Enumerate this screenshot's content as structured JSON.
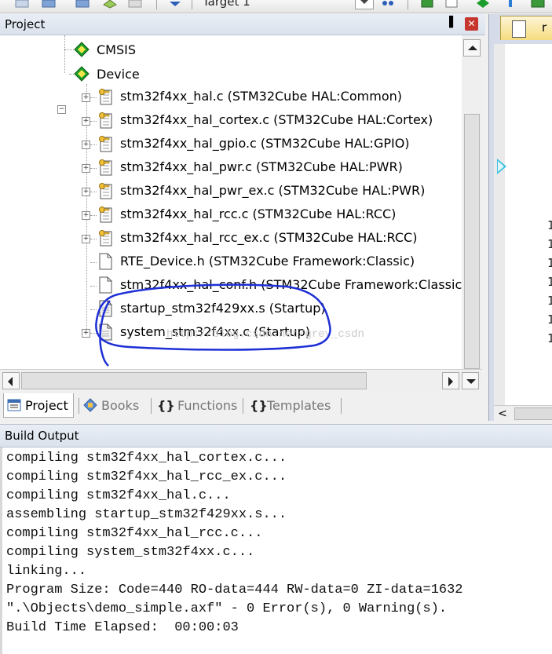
{
  "toolbar": {
    "target_label": "Target 1"
  },
  "project_pane": {
    "title": "Project",
    "pin_glyph": "▐",
    "close_glyph": "✕",
    "tree": [
      {
        "label": "CMSIS",
        "icon": "gem-icon",
        "level": 0,
        "expander": ""
      },
      {
        "label": "Device",
        "icon": "gem-icon",
        "level": 0,
        "expander": "−"
      },
      {
        "label": "stm32f4xx_hal.c (STM32Cube HAL:Common)",
        "icon": "key-file-icon",
        "level": 1,
        "expander": "+"
      },
      {
        "label": "stm32f4xx_hal_cortex.c (STM32Cube HAL:Cortex)",
        "icon": "key-file-icon",
        "level": 1,
        "expander": "+"
      },
      {
        "label": "stm32f4xx_hal_gpio.c (STM32Cube HAL:GPIO)",
        "icon": "key-file-icon",
        "level": 1,
        "expander": "+"
      },
      {
        "label": "stm32f4xx_hal_pwr.c (STM32Cube HAL:PWR)",
        "icon": "key-file-icon",
        "level": 1,
        "expander": "+"
      },
      {
        "label": "stm32f4xx_hal_pwr_ex.c (STM32Cube HAL:PWR)",
        "icon": "key-file-icon",
        "level": 1,
        "expander": "+"
      },
      {
        "label": "stm32f4xx_hal_rcc.c (STM32Cube HAL:RCC)",
        "icon": "key-file-icon",
        "level": 1,
        "expander": "+"
      },
      {
        "label": "stm32f4xx_hal_rcc_ex.c (STM32Cube HAL:RCC)",
        "icon": "key-file-icon",
        "level": 1,
        "expander": "+"
      },
      {
        "label": "RTE_Device.h (STM32Cube Framework:Classic)",
        "icon": "file-icon",
        "level": 1,
        "expander": ""
      },
      {
        "label": "stm32f4xx_hal_conf.h (STM32Cube Framework:Classic)",
        "icon": "file-icon",
        "level": 1,
        "expander": ""
      },
      {
        "label": "startup_stm32f429xx.s (Startup)",
        "icon": "asm-file-icon",
        "level": 1,
        "expander": ""
      },
      {
        "label": "system_stm32f4xx.c (Startup)",
        "icon": "asm-file-icon",
        "level": 1,
        "expander": "+"
      }
    ],
    "tabs": [
      {
        "label": "Project",
        "active": true,
        "icon": "project-tab-icon"
      },
      {
        "label": "Books",
        "active": false,
        "icon": "books-tab-icon"
      },
      {
        "label": "Functions",
        "active": false,
        "icon": "functions-tab-icon",
        "glyph": "{}"
      },
      {
        "label": "Templates",
        "active": false,
        "icon": "templates-tab-icon",
        "glyph": "{}"
      }
    ]
  },
  "editor": {
    "line_numbers": [
      "1",
      "1",
      "1",
      "1",
      "1",
      "1",
      "1"
    ],
    "tab_text": "r",
    "scroll_left_glyph": "<"
  },
  "build_output": {
    "title": "Build Output",
    "lines": [
      "compiling stm32f4xx_hal_cortex.c...",
      "compiling stm32f4xx_hal_rcc_ex.c...",
      "compiling stm32f4xx_hal.c...",
      "assembling startup_stm32f429xx.s...",
      "compiling stm32f4xx_hal_rcc.c...",
      "compiling system_stm32f4xx.c...",
      "linking...",
      "Program Size: Code=440 RO-data=444 RW-data=0 ZI-data=1632",
      "\".\\Objects\\demo_simple.axf\" - 0 Error(s), 0 Warning(s).",
      "Build Time Elapsed:  00:00:03"
    ]
  },
  "watermark": "http://blog.csdn.net/grey_csdn",
  "colors": {
    "annotation": "#1e2fd6",
    "close": "#c6362e",
    "gem": "#1a9d2a",
    "tab_accent": "#f5dc7f"
  }
}
